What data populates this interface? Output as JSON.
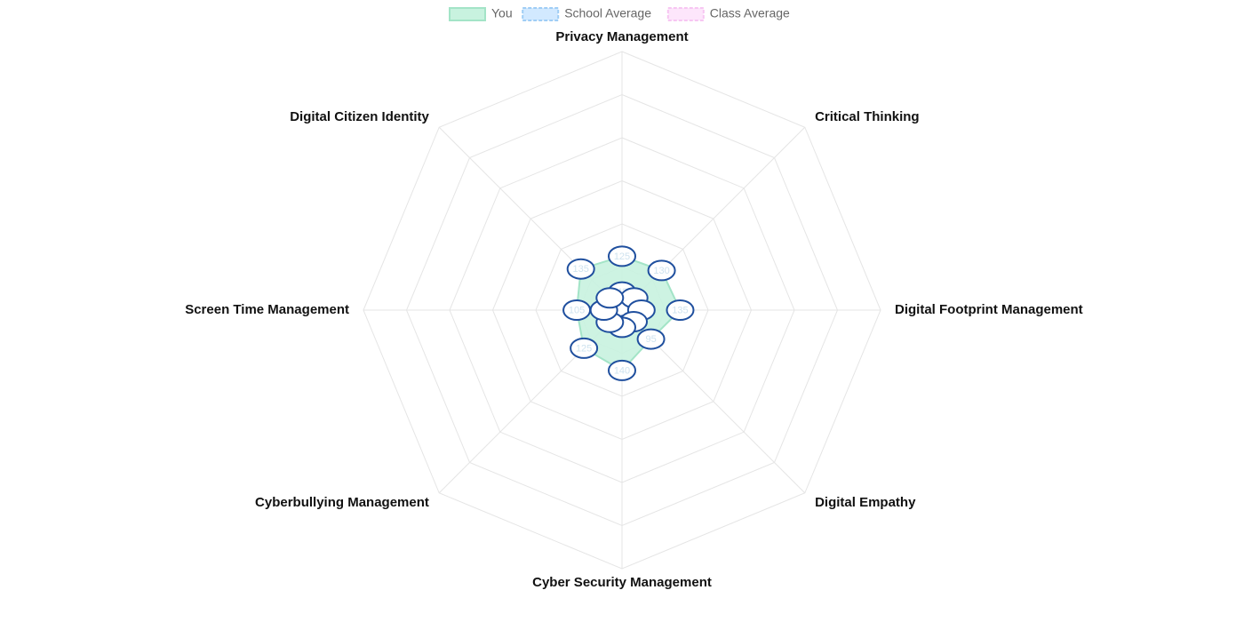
{
  "chart_data": {
    "type": "radar",
    "categories": [
      "Privacy Management",
      "Critical Thinking",
      "Digital Footprint Management",
      "Digital Empathy",
      "Cyber Security Management",
      "Cyberbullying Management",
      "Screen Time Management",
      "Digital Citizen Identity"
    ],
    "r_range": [
      0,
      600
    ],
    "grid": true,
    "legend_position": "top",
    "series": [
      {
        "name": "You",
        "values": [
          125,
          130,
          135,
          95,
          140,
          125,
          105,
          135
        ],
        "fill": "#c8f2df",
        "stroke": "#a3e4c7",
        "dashed": false
      },
      {
        "name": "School Average",
        "values": [
          42,
          40,
          45,
          38,
          40,
          40,
          42,
          40
        ],
        "fill": "#d2e9ff",
        "stroke": "#9fcdf5",
        "dashed": true
      },
      {
        "name": "Class Average",
        "values": [
          12,
          12,
          12,
          12,
          12,
          12,
          12,
          12
        ],
        "fill": "#fde6fb",
        "stroke": "#f7c6f2",
        "dashed": true
      }
    ],
    "data_label_visible": {
      "You": [
        true,
        true,
        true,
        true,
        true,
        true,
        true,
        true
      ],
      "School Average": [
        true,
        false,
        false,
        false,
        false,
        false,
        false,
        false
      ],
      "Class Average": [
        false,
        false,
        false,
        false,
        false,
        false,
        false,
        false
      ]
    }
  },
  "colors": {
    "grid": "#e5e5e5",
    "data_label_border": "#1f4f9e",
    "data_label_text": "#cfe3ef"
  }
}
